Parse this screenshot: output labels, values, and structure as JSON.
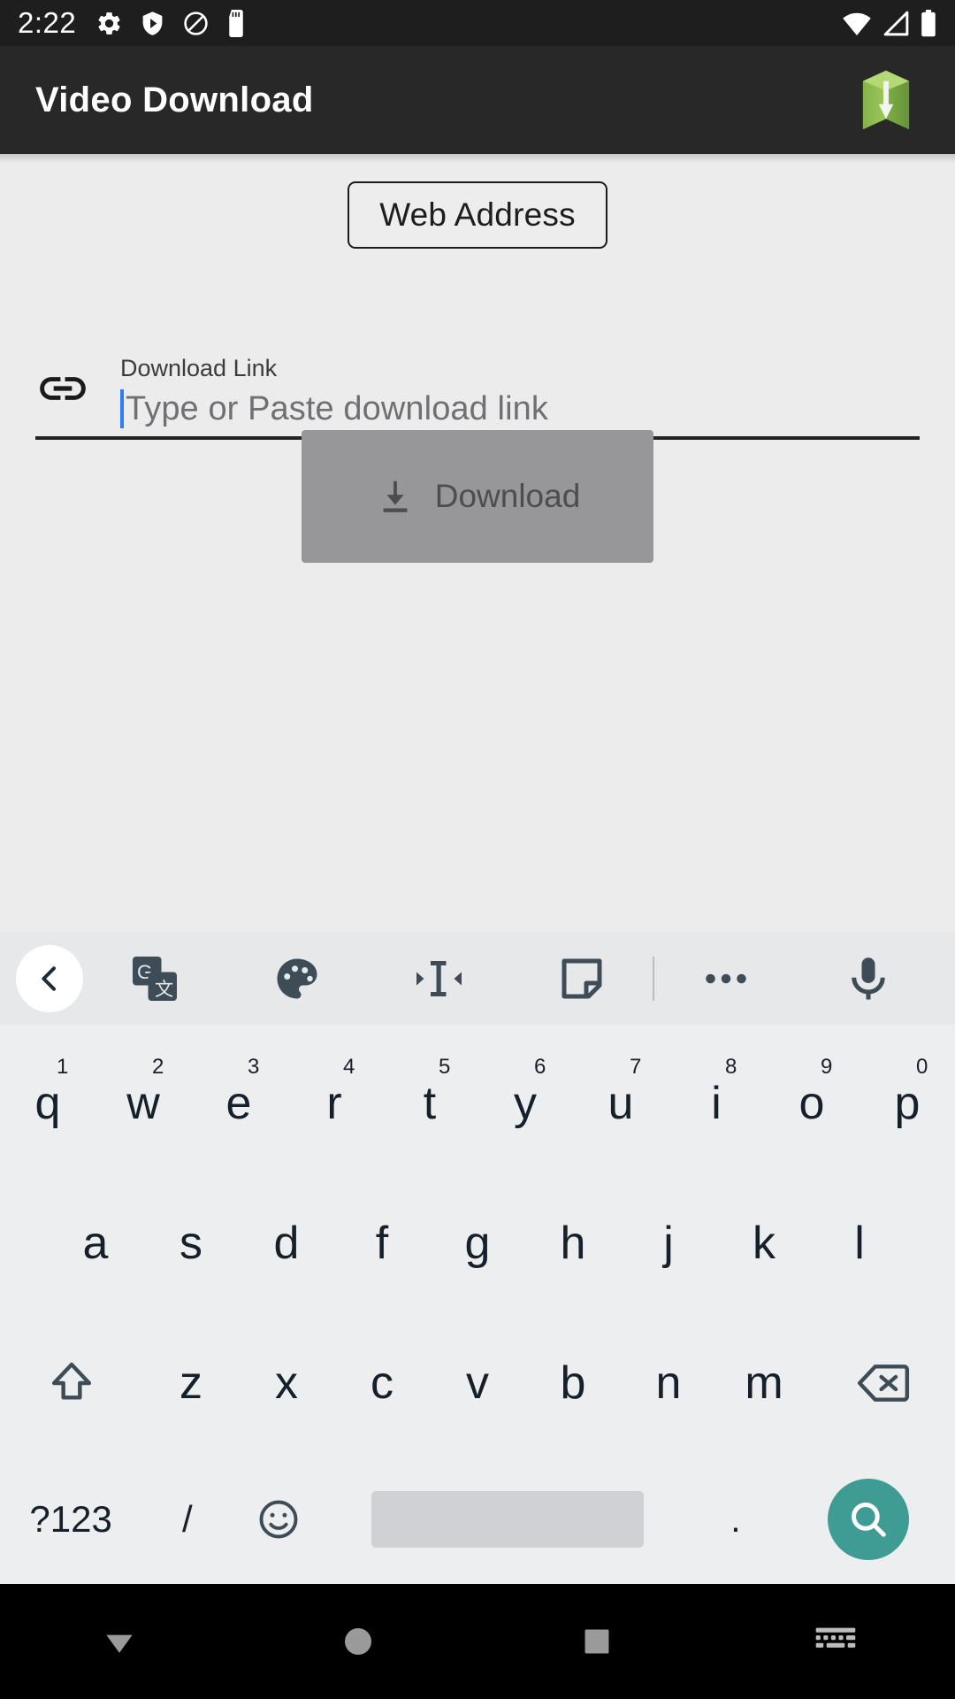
{
  "status_bar": {
    "time": "2:22",
    "left_icons": [
      "settings-gear-icon",
      "play-protect-shield-icon",
      "no-sim-blocked-icon",
      "sd-card-icon"
    ],
    "right_icons": [
      "wifi-icon",
      "cellular-signal-icon",
      "battery-icon"
    ]
  },
  "app_bar": {
    "title": "Video Download",
    "logo": "green-box-download-logo"
  },
  "main": {
    "web_address_button": "Web Address",
    "download_link_field": {
      "icon": "link-chain-icon",
      "label": "Download Link",
      "placeholder": "Type or Paste download link",
      "value": ""
    },
    "download_button": {
      "label": "Download",
      "icon": "download-arrow-icon",
      "enabled": false
    }
  },
  "keyboard": {
    "toolbar": [
      "back-chevron-icon",
      "google-translate-icon",
      "palette-theme-icon",
      "text-edit-cursor-icon",
      "handwriting-sticker-icon",
      "divider",
      "more-options-icon",
      "microphone-icon"
    ],
    "row1": [
      {
        "letter": "q",
        "num": "1"
      },
      {
        "letter": "w",
        "num": "2"
      },
      {
        "letter": "e",
        "num": "3"
      },
      {
        "letter": "r",
        "num": "4"
      },
      {
        "letter": "t",
        "num": "5"
      },
      {
        "letter": "y",
        "num": "6"
      },
      {
        "letter": "u",
        "num": "7"
      },
      {
        "letter": "i",
        "num": "8"
      },
      {
        "letter": "o",
        "num": "9"
      },
      {
        "letter": "p",
        "num": "0"
      }
    ],
    "row2": [
      "a",
      "s",
      "d",
      "f",
      "g",
      "h",
      "j",
      "k",
      "l"
    ],
    "row3": [
      "z",
      "x",
      "c",
      "v",
      "b",
      "n",
      "m"
    ],
    "shift_key": "shift-arrow-icon",
    "backspace_key": "backspace-icon",
    "row4": {
      "symbols_key": "?123",
      "slash_key": "/",
      "emoji_key": "emoji-smiley-icon",
      "space_key": "spacebar",
      "period_key": ".",
      "search_key": "search-magnifier-icon"
    }
  },
  "nav_bar": {
    "back": "back-triangle-icon",
    "home": "home-circle-icon",
    "recents": "recents-square-icon",
    "dismiss_keyboard": "keyboard-dismiss-icon"
  },
  "colors": {
    "status_bar_bg": "#1e1e1e",
    "app_bar_bg": "#282828",
    "content_bg": "#ececed",
    "download_btn_bg": "#979799",
    "keyboard_bg": "#eceef0",
    "search_key_bg": "#3f9c94",
    "caret": "#2d7cf6",
    "nav_bar_bg": "#000000"
  }
}
